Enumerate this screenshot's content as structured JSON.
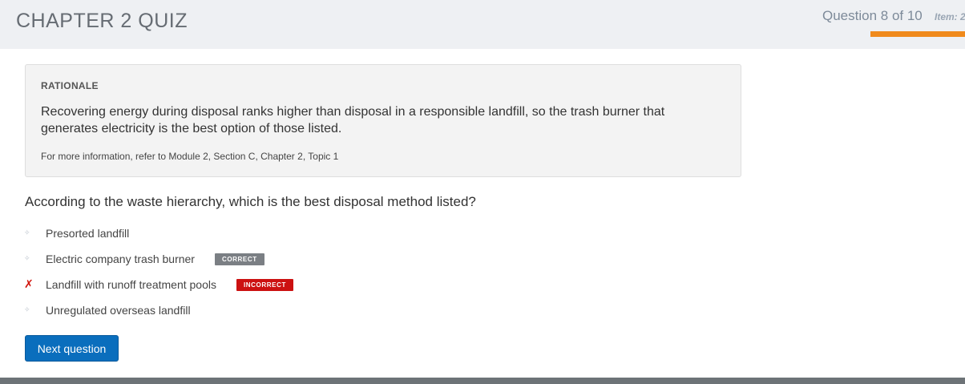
{
  "header": {
    "title": "CHAPTER 2 QUIZ",
    "progress_text": "Question 8 of 10",
    "item_text": "Item: 2"
  },
  "rationale": {
    "heading": "RATIONALE",
    "body": "Recovering energy during disposal ranks higher than disposal in a responsible landfill, so the trash burner that generates electricity is the best option of those listed.",
    "reference": "For more information, refer to Module 2, Section C, Chapter 2, Topic 1"
  },
  "question": {
    "text": "According to the waste hierarchy, which is the best disposal method listed?"
  },
  "answers": [
    {
      "label": "Presorted landfill",
      "marker": "✧",
      "badge": ""
    },
    {
      "label": "Electric company trash burner",
      "marker": "✧",
      "badge": "CORRECT"
    },
    {
      "label": "Landfill with runoff treatment pools",
      "marker": "✗",
      "badge": "INCORRECT"
    },
    {
      "label": "Unregulated overseas landfill",
      "marker": "✧",
      "badge": ""
    }
  ],
  "actions": {
    "next_label": "Next question"
  },
  "colors": {
    "header_bg": "#eef0f3",
    "progress_orange": "#f08a1c",
    "button_blue": "#0a6ebd",
    "correct_gray": "#7b7f84",
    "incorrect_red": "#cc1111"
  }
}
